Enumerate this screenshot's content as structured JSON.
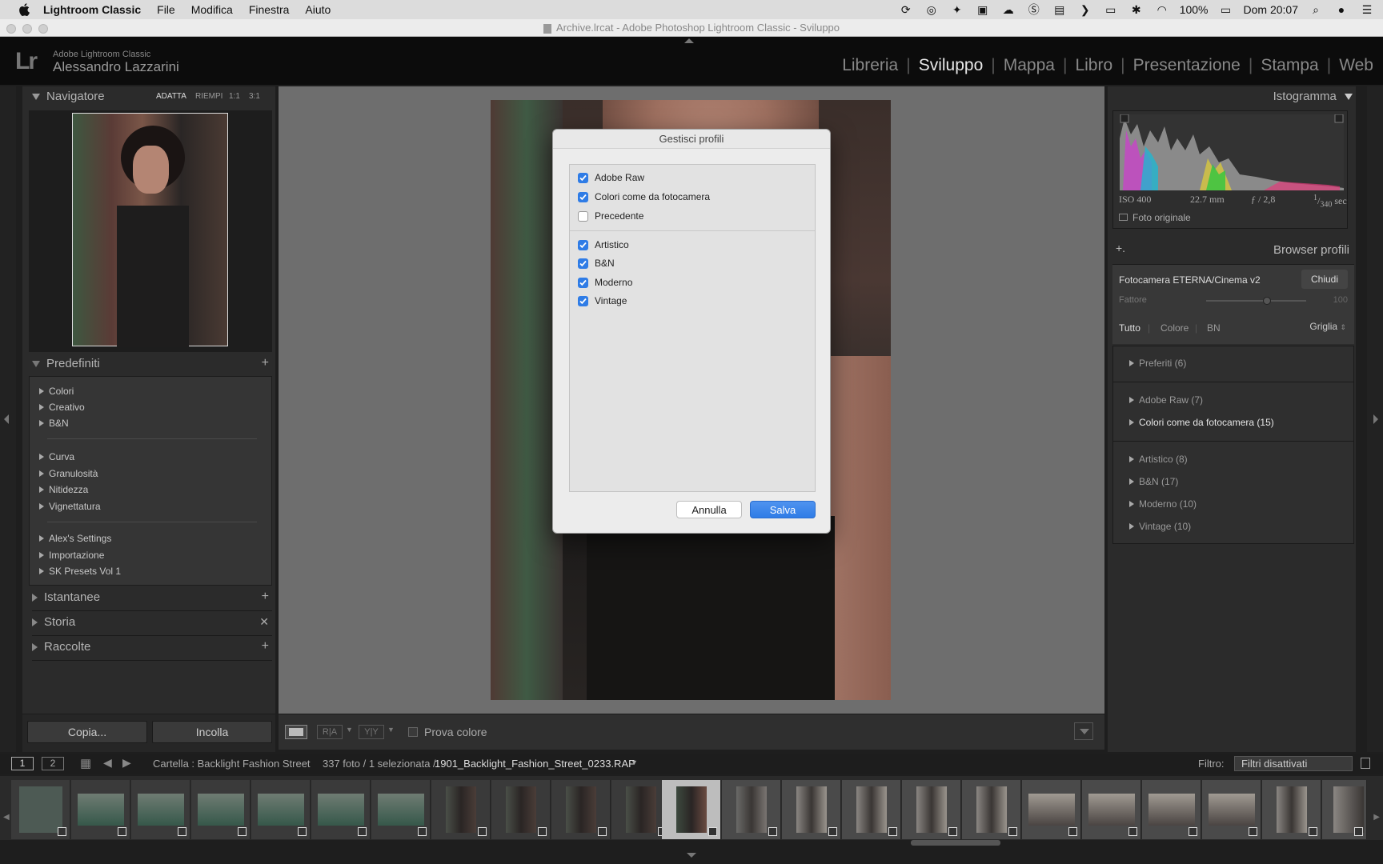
{
  "menubar": {
    "app_name": "Lightroom Classic",
    "items": [
      "File",
      "Modifica",
      "Finestra",
      "Aiuto"
    ],
    "battery": "100%",
    "clock": "Dom 20:07"
  },
  "window": {
    "title": "Archive.lrcat - Adobe Photoshop Lightroom Classic - Sviluppo"
  },
  "identity": {
    "product": "Adobe Lightroom Classic",
    "user": "Alessandro Lazzarini",
    "logo": "Lr"
  },
  "modules": [
    "Libreria",
    "Sviluppo",
    "Mappa",
    "Libro",
    "Presentazione",
    "Stampa",
    "Web"
  ],
  "active_module": "Sviluppo",
  "left": {
    "navigator": {
      "title": "Navigatore",
      "zoom": [
        "ADATTA",
        "RIEMPI",
        "1:1",
        "3:1"
      ]
    },
    "presets": {
      "title": "Predefiniti",
      "group1": [
        "Colori",
        "Creativo",
        "B&N"
      ],
      "group2": [
        "Curva",
        "Granulosità",
        "Nitidezza",
        "Vignettatura"
      ],
      "group3": [
        "Alex's Settings",
        "Importazione",
        "SK Presets Vol 1"
      ]
    },
    "snapshots": "Istantanee",
    "history": "Storia",
    "collections": "Raccolte",
    "copy_btn": "Copia...",
    "paste_btn": "Incolla"
  },
  "dialog": {
    "title": "Gestisci profili",
    "items_top": [
      {
        "label": "Adobe Raw",
        "checked": true
      },
      {
        "label": "Colori come da fotocamera",
        "checked": true
      },
      {
        "label": "Precedente",
        "checked": false
      }
    ],
    "items_bottom": [
      {
        "label": "Artistico",
        "checked": true
      },
      {
        "label": "B&N",
        "checked": true
      },
      {
        "label": "Moderno",
        "checked": true
      },
      {
        "label": "Vintage",
        "checked": true
      }
    ],
    "cancel": "Annulla",
    "save": "Salva"
  },
  "right": {
    "histogram": {
      "title": "Istogramma",
      "iso": "ISO 400",
      "focal": "22.7 mm",
      "aperture": "ƒ / 2,8",
      "shutter_num": "1",
      "shutter_den": "340",
      "shutter_unit": "sec",
      "original": "Foto originale"
    },
    "profile_browser": {
      "add": "+.",
      "title": "Browser profili",
      "current": "Fotocamera ETERNA/Cinema v2",
      "close": "Chiudi",
      "amount_label": "Fattore",
      "amount_value": "100",
      "amount_level": 0.61,
      "filters": [
        "Tutto",
        "Colore",
        "BN"
      ],
      "view": "Griglia",
      "groups": [
        "Preferiti (6)",
        "Adobe Raw (7)",
        "Colori come da fotocamera (15)",
        "Artistico (8)",
        "B&N (17)",
        "Moderno (10)",
        "Vintage (10)"
      ]
    }
  },
  "toolbar": {
    "softproof": "Prova colore"
  },
  "filmstrip_bar": {
    "page1": "1",
    "page2": "2",
    "source": "Cartella : Backlight Fashion Street",
    "count": "337 foto / 1 selezionata /",
    "filename": "1901_Backlight_Fashion_Street_0233.RAF",
    "filter_label": "Filtro:",
    "filter_value": "Filtri disattivati"
  },
  "colors": {
    "accent": "#2f7ce6",
    "panel": "#2b2b2b",
    "center_bg": "#6e6e6e"
  }
}
